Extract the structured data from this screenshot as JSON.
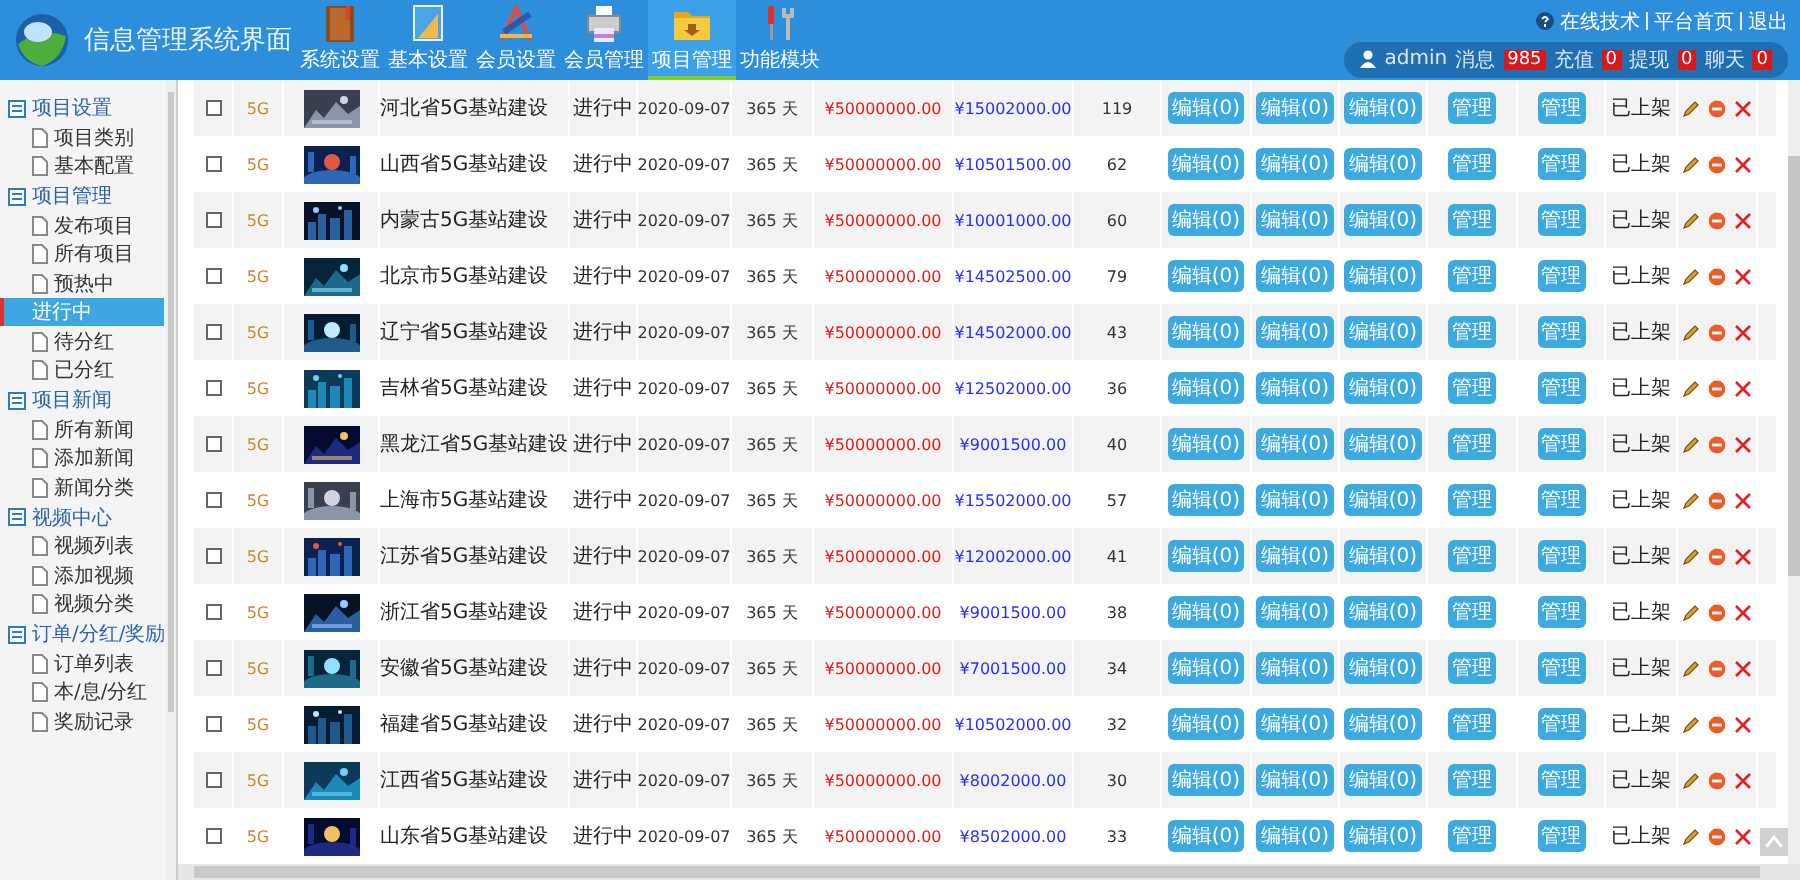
{
  "header": {
    "title": "信息管理系统界面",
    "nav": [
      {
        "label": "系统设置",
        "selected": false
      },
      {
        "label": "基本设置",
        "selected": false
      },
      {
        "label": "会员设置",
        "selected": false
      },
      {
        "label": "会员管理",
        "selected": false
      },
      {
        "label": "项目管理",
        "selected": true
      },
      {
        "label": "功能模块",
        "selected": false
      }
    ],
    "links": [
      "在线技术",
      "平台首页",
      "退出"
    ],
    "user": {
      "name": "admin",
      "counters": [
        {
          "label": "消息",
          "count": "985"
        },
        {
          "label": "充值",
          "count": "0"
        },
        {
          "label": "提现",
          "count": "0"
        },
        {
          "label": "聊天",
          "count": "0"
        }
      ]
    }
  },
  "sidebar": {
    "groups": [
      {
        "label": "项目设置",
        "children": [
          {
            "label": "项目类别",
            "selected": false
          },
          {
            "label": "基本配置",
            "selected": false
          }
        ]
      },
      {
        "label": "项目管理",
        "children": [
          {
            "label": "发布项目",
            "selected": false
          },
          {
            "label": "所有项目",
            "selected": false
          },
          {
            "label": "预热中",
            "selected": false
          },
          {
            "label": "进行中",
            "selected": true
          },
          {
            "label": "待分红",
            "selected": false
          },
          {
            "label": "已分红",
            "selected": false
          }
        ]
      },
      {
        "label": "项目新闻",
        "children": [
          {
            "label": "所有新闻",
            "selected": false
          },
          {
            "label": "添加新闻",
            "selected": false
          },
          {
            "label": "新闻分类",
            "selected": false
          }
        ]
      },
      {
        "label": "视频中心",
        "children": [
          {
            "label": "视频列表",
            "selected": false
          },
          {
            "label": "添加视频",
            "selected": false
          },
          {
            "label": "视频分类",
            "selected": false
          }
        ]
      },
      {
        "label": "订单/分红/奖励",
        "children": [
          {
            "label": "订单列表",
            "selected": false
          },
          {
            "label": "本/息/分红",
            "selected": false
          },
          {
            "label": "奖励记录",
            "selected": false
          }
        ]
      }
    ]
  },
  "table": {
    "rows": [
      {
        "checked": false,
        "tag": "5G",
        "name": "河北省5G基站建设",
        "status": "进行中",
        "date": "2020-09-07",
        "days": "365 天",
        "target": "¥50000000.00",
        "raised": "¥15002000.00",
        "count": "119",
        "buttons": [
          "编辑(0)",
          "编辑(0)",
          "编辑(0)",
          "管理",
          "管理"
        ],
        "shelf": "已上架"
      },
      {
        "checked": false,
        "tag": "5G",
        "name": "山西省5G基站建设",
        "status": "进行中",
        "date": "2020-09-07",
        "days": "365 天",
        "target": "¥50000000.00",
        "raised": "¥10501500.00",
        "count": "62",
        "buttons": [
          "编辑(0)",
          "编辑(0)",
          "编辑(0)",
          "管理",
          "管理"
        ],
        "shelf": "已上架"
      },
      {
        "checked": false,
        "tag": "5G",
        "name": "内蒙古5G基站建设",
        "status": "进行中",
        "date": "2020-09-07",
        "days": "365 天",
        "target": "¥50000000.00",
        "raised": "¥10001000.00",
        "count": "60",
        "buttons": [
          "编辑(0)",
          "编辑(0)",
          "编辑(0)",
          "管理",
          "管理"
        ],
        "shelf": "已上架"
      },
      {
        "checked": false,
        "tag": "5G",
        "name": "北京市5G基站建设",
        "status": "进行中",
        "date": "2020-09-07",
        "days": "365 天",
        "target": "¥50000000.00",
        "raised": "¥14502500.00",
        "count": "79",
        "buttons": [
          "编辑(0)",
          "编辑(0)",
          "编辑(0)",
          "管理",
          "管理"
        ],
        "shelf": "已上架"
      },
      {
        "checked": false,
        "tag": "5G",
        "name": "辽宁省5G基站建设",
        "status": "进行中",
        "date": "2020-09-07",
        "days": "365 天",
        "target": "¥50000000.00",
        "raised": "¥14502000.00",
        "count": "43",
        "buttons": [
          "编辑(0)",
          "编辑(0)",
          "编辑(0)",
          "管理",
          "管理"
        ],
        "shelf": "已上架"
      },
      {
        "checked": false,
        "tag": "5G",
        "name": "吉林省5G基站建设",
        "status": "进行中",
        "date": "2020-09-07",
        "days": "365 天",
        "target": "¥50000000.00",
        "raised": "¥12502000.00",
        "count": "36",
        "buttons": [
          "编辑(0)",
          "编辑(0)",
          "编辑(0)",
          "管理",
          "管理"
        ],
        "shelf": "已上架"
      },
      {
        "checked": false,
        "tag": "5G",
        "name": "黑龙江省5G基站建设",
        "status": "进行中",
        "date": "2020-09-07",
        "days": "365 天",
        "target": "¥50000000.00",
        "raised": "¥9001500.00",
        "count": "40",
        "buttons": [
          "编辑(0)",
          "编辑(0)",
          "编辑(0)",
          "管理",
          "管理"
        ],
        "shelf": "已上架"
      },
      {
        "checked": false,
        "tag": "5G",
        "name": "上海市5G基站建设",
        "status": "进行中",
        "date": "2020-09-07",
        "days": "365 天",
        "target": "¥50000000.00",
        "raised": "¥15502000.00",
        "count": "57",
        "buttons": [
          "编辑(0)",
          "编辑(0)",
          "编辑(0)",
          "管理",
          "管理"
        ],
        "shelf": "已上架"
      },
      {
        "checked": false,
        "tag": "5G",
        "name": "江苏省5G基站建设",
        "status": "进行中",
        "date": "2020-09-07",
        "days": "365 天",
        "target": "¥50000000.00",
        "raised": "¥12002000.00",
        "count": "41",
        "buttons": [
          "编辑(0)",
          "编辑(0)",
          "编辑(0)",
          "管理",
          "管理"
        ],
        "shelf": "已上架"
      },
      {
        "checked": false,
        "tag": "5G",
        "name": "浙江省5G基站建设",
        "status": "进行中",
        "date": "2020-09-07",
        "days": "365 天",
        "target": "¥50000000.00",
        "raised": "¥9001500.00",
        "count": "38",
        "buttons": [
          "编辑(0)",
          "编辑(0)",
          "编辑(0)",
          "管理",
          "管理"
        ],
        "shelf": "已上架"
      },
      {
        "checked": false,
        "tag": "5G",
        "name": "安徽省5G基站建设",
        "status": "进行中",
        "date": "2020-09-07",
        "days": "365 天",
        "target": "¥50000000.00",
        "raised": "¥7001500.00",
        "count": "34",
        "buttons": [
          "编辑(0)",
          "编辑(0)",
          "编辑(0)",
          "管理",
          "管理"
        ],
        "shelf": "已上架"
      },
      {
        "checked": false,
        "tag": "5G",
        "name": "福建省5G基站建设",
        "status": "进行中",
        "date": "2020-09-07",
        "days": "365 天",
        "target": "¥50000000.00",
        "raised": "¥10502000.00",
        "count": "32",
        "buttons": [
          "编辑(0)",
          "编辑(0)",
          "编辑(0)",
          "管理",
          "管理"
        ],
        "shelf": "已上架"
      },
      {
        "checked": false,
        "tag": "5G",
        "name": "江西省5G基站建设",
        "status": "进行中",
        "date": "2020-09-07",
        "days": "365 天",
        "target": "¥50000000.00",
        "raised": "¥8002000.00",
        "count": "30",
        "buttons": [
          "编辑(0)",
          "编辑(0)",
          "编辑(0)",
          "管理",
          "管理"
        ],
        "shelf": "已上架"
      },
      {
        "checked": false,
        "tag": "5G",
        "name": "山东省5G基站建设",
        "status": "进行中",
        "date": "2020-09-07",
        "days": "365 天",
        "target": "¥50000000.00",
        "raised": "¥8502000.00",
        "count": "33",
        "buttons": [
          "编辑(0)",
          "编辑(0)",
          "编辑(0)",
          "管理",
          "管理"
        ],
        "shelf": "已上架"
      }
    ]
  }
}
